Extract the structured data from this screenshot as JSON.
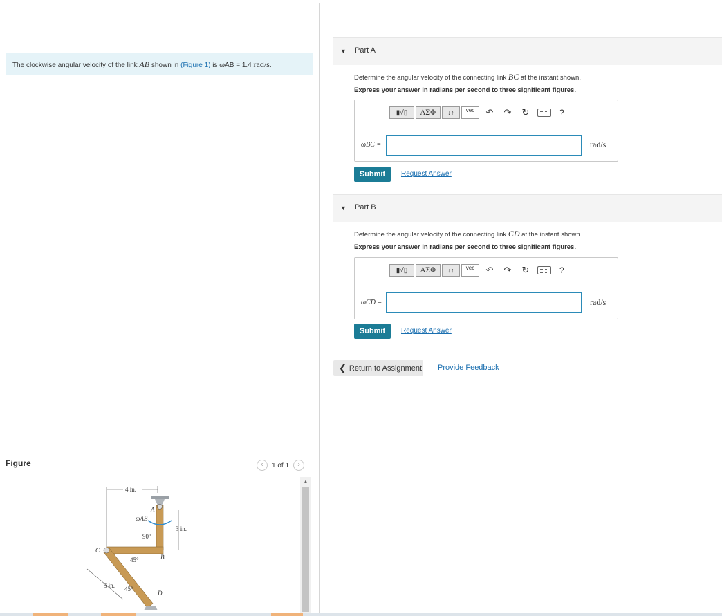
{
  "problem": {
    "text_before": "The clockwise angular velocity of the link ",
    "link": "AB",
    "text_mid": " shown in ",
    "figure_link": "(Figure 1)",
    "text_is": " is ",
    "omega": "ωAB",
    "equals": " = 1.4 ",
    "unit": "rad/s",
    "period": "."
  },
  "figure": {
    "label": "Figure",
    "pager": "1 of 1",
    "prev_icon": "chevron-left-icon",
    "next_icon": "chevron-right-icon",
    "labels": {
      "dim_4in": "4 in.",
      "dim_3in": "3 in.",
      "dim_5in": "5 in.",
      "omega_ab": "ωAB",
      "angle_90": "90°",
      "angle_45a": "45°",
      "angle_45b": "45°",
      "A": "A",
      "B": "B",
      "C": "C",
      "D": "D"
    }
  },
  "parts": [
    {
      "title": "Part A",
      "q_before": "Determine the angular velocity of the connecting link ",
      "q_link": "BC",
      "q_after": " at the instant shown.",
      "instruction": "Express your answer in radians per second to three significant figures.",
      "answer_label": "ωBC =",
      "answer_value": "",
      "unit": "rad/s",
      "submit": "Submit",
      "request": "Request Answer"
    },
    {
      "title": "Part B",
      "q_before": "Determine the angular velocity of the connecting link ",
      "q_link": "CD",
      "q_after": " at the instant shown.",
      "instruction": "Express your answer in radians per second to three significant figures.",
      "answer_label": "ωCD =",
      "answer_value": "",
      "unit": "rad/s",
      "submit": "Submit",
      "request": "Request Answer"
    }
  ],
  "toolbar": {
    "templates": "▮√▯",
    "greek": "ΑΣΦ",
    "arrows": "↓↑",
    "vec": "vec",
    "undo_icon": "undo-icon",
    "redo_icon": "redo-icon",
    "reset_icon": "reset-icon",
    "keyboard_icon": "keyboard-icon",
    "help": "?"
  },
  "footer": {
    "return": "Return to Assignment",
    "feedback": "Provide Feedback"
  },
  "colors": {
    "accent": "#1b7c96",
    "link": "#1a6fb0",
    "problem_bg": "#e5f3f8",
    "link_member": "#c89a55"
  }
}
